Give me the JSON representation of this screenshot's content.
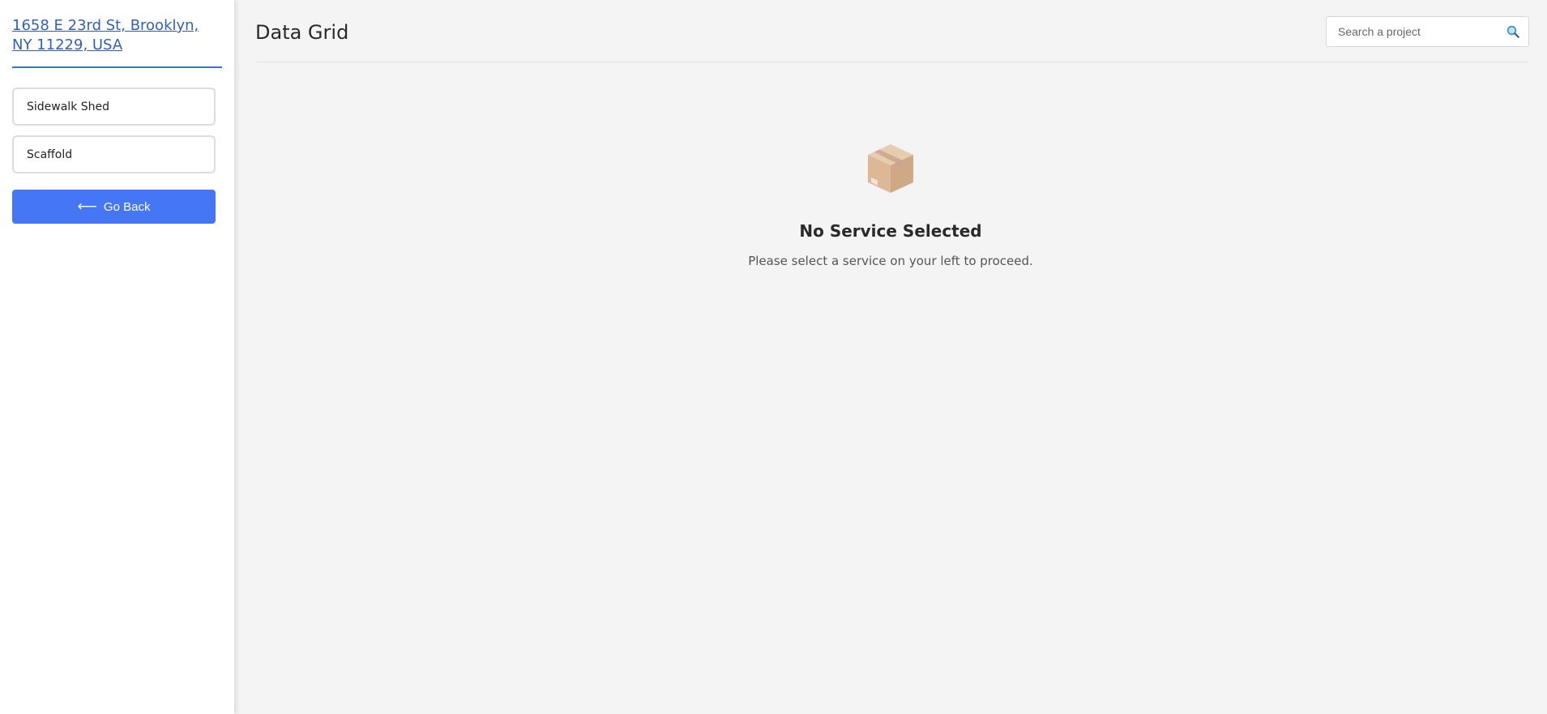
{
  "sidebar": {
    "address": "1658 E 23rd St, Brooklyn, NY 11229, USA",
    "services": [
      {
        "label": "Sidewalk Shed"
      },
      {
        "label": "Scaffold"
      }
    ],
    "go_back_label": "Go Back",
    "go_back_icon": "left-arrow-icon"
  },
  "header": {
    "title": "Data Grid",
    "search_placeholder": "Search a project",
    "search_icon": "search-icon"
  },
  "empty_state": {
    "icon": "package-box-icon",
    "title": "No Service Selected",
    "subtitle": "Please select a service on your left to proceed."
  },
  "colors": {
    "accent": "#4476f5",
    "link": "#2f5fc4",
    "background": "#f4f4f4"
  }
}
